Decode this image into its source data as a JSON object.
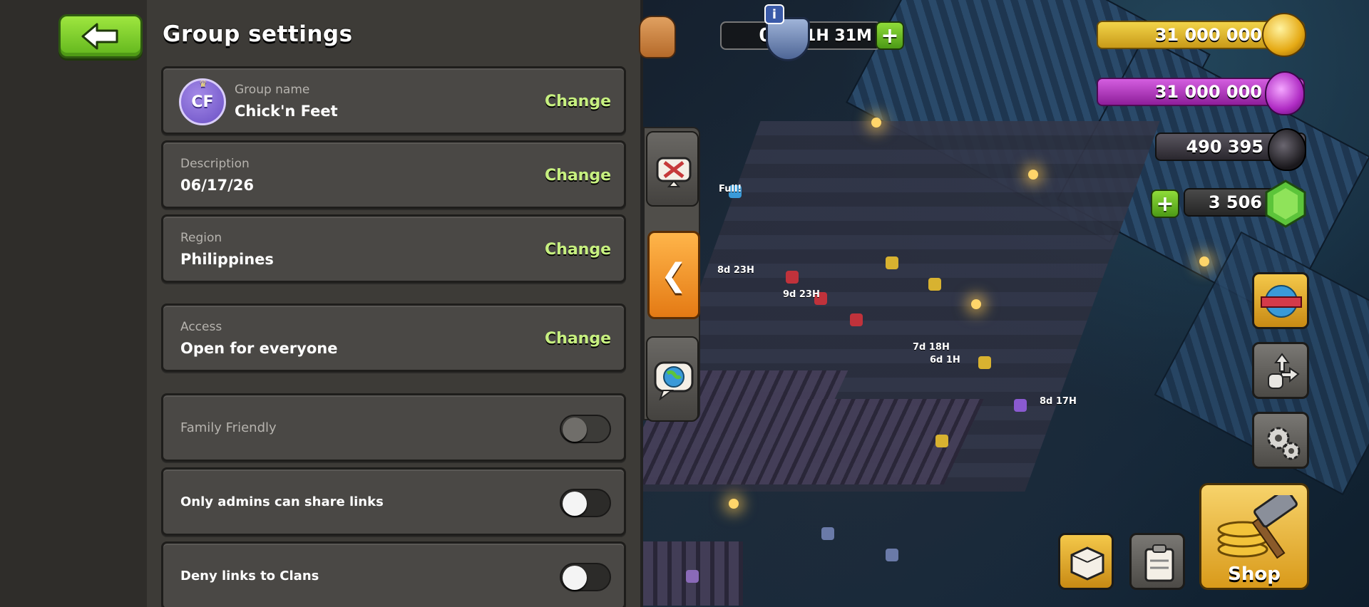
{
  "panel": {
    "title": "Group settings",
    "back_icon": "arrow-left-icon"
  },
  "group_name": {
    "label": "Group name",
    "value": "Chick'n Feet",
    "avatar_initials": "CF",
    "action": "Change"
  },
  "description": {
    "label": "Description",
    "value": "06/17/26",
    "action": "Change"
  },
  "region": {
    "label": "Region",
    "value": "Philippines",
    "action": "Change"
  },
  "access": {
    "label": "Access",
    "value": "Open for everyone",
    "action": "Change"
  },
  "toggles": [
    {
      "label": "Family Friendly",
      "on": false,
      "disabled": true
    },
    {
      "label": "Only admins can share links",
      "on": false,
      "disabled": false
    },
    {
      "label": "Deny links to Clans",
      "on": false,
      "disabled": false
    }
  ],
  "hud": {
    "builders": "0/6",
    "shield_time": "1H 31M",
    "info_badge": "i",
    "gold": "31 000 000",
    "elixir": "31 000 000",
    "dark_elixir": "490 395",
    "gems": "3 506",
    "plus": "+",
    "collapse_glyph": "❮",
    "shop_label": "Shop",
    "scene_labels": {
      "full": "Full!",
      "timer_a": "8d 23H",
      "timer_b": "9d 23H",
      "timer_c": "7d 18H",
      "timer_d": "6d 1H",
      "timer_e": "8d 17H"
    }
  },
  "colors": {
    "accent_green": "#c7f080",
    "panel_bg": "#3d3b37",
    "row_bg": "#4a4845",
    "gold": "#f2d44a",
    "elixir": "#d45ee0"
  }
}
